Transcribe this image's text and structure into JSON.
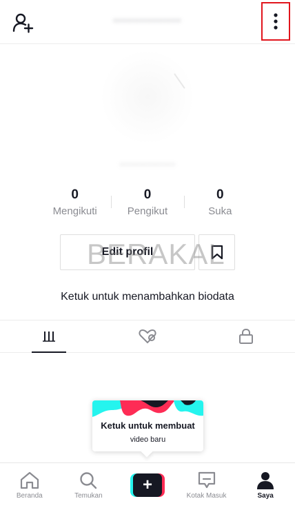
{
  "header": {
    "username": "·················",
    "add_user_icon": "add-user-icon",
    "menu_icon": "vertical-dots-icon"
  },
  "profile": {
    "display_name": "··············",
    "stats": [
      {
        "value": "0",
        "label": "Mengikuti"
      },
      {
        "value": "0",
        "label": "Pengikut"
      },
      {
        "value": "0",
        "label": "Suka"
      }
    ],
    "edit_label": "Edit profil",
    "watermark": "BERAKAL",
    "bio_prompt": "Ketuk untuk menambahkan biodata"
  },
  "tabs": [
    {
      "icon": "grid-icon",
      "active": true
    },
    {
      "icon": "liked-icon",
      "active": false
    },
    {
      "icon": "lock-icon",
      "active": false
    }
  ],
  "tooltip": {
    "title": "Ketuk untuk membuat",
    "subtitle": "video baru"
  },
  "bottom_nav": [
    {
      "label": "Beranda",
      "icon": "home-icon"
    },
    {
      "label": "Temukan",
      "icon": "search-icon"
    },
    {
      "label": "",
      "icon": "plus-icon",
      "symbol": "+"
    },
    {
      "label": "Kotak Masuk",
      "icon": "inbox-icon"
    },
    {
      "label": "Saya",
      "icon": "profile-icon",
      "active": true
    }
  ],
  "colors": {
    "accent_pink": "#fe2c55",
    "accent_cyan": "#25f4ee",
    "dark": "#161823",
    "muted": "#8a8b91",
    "highlight_red": "#e1141c"
  }
}
